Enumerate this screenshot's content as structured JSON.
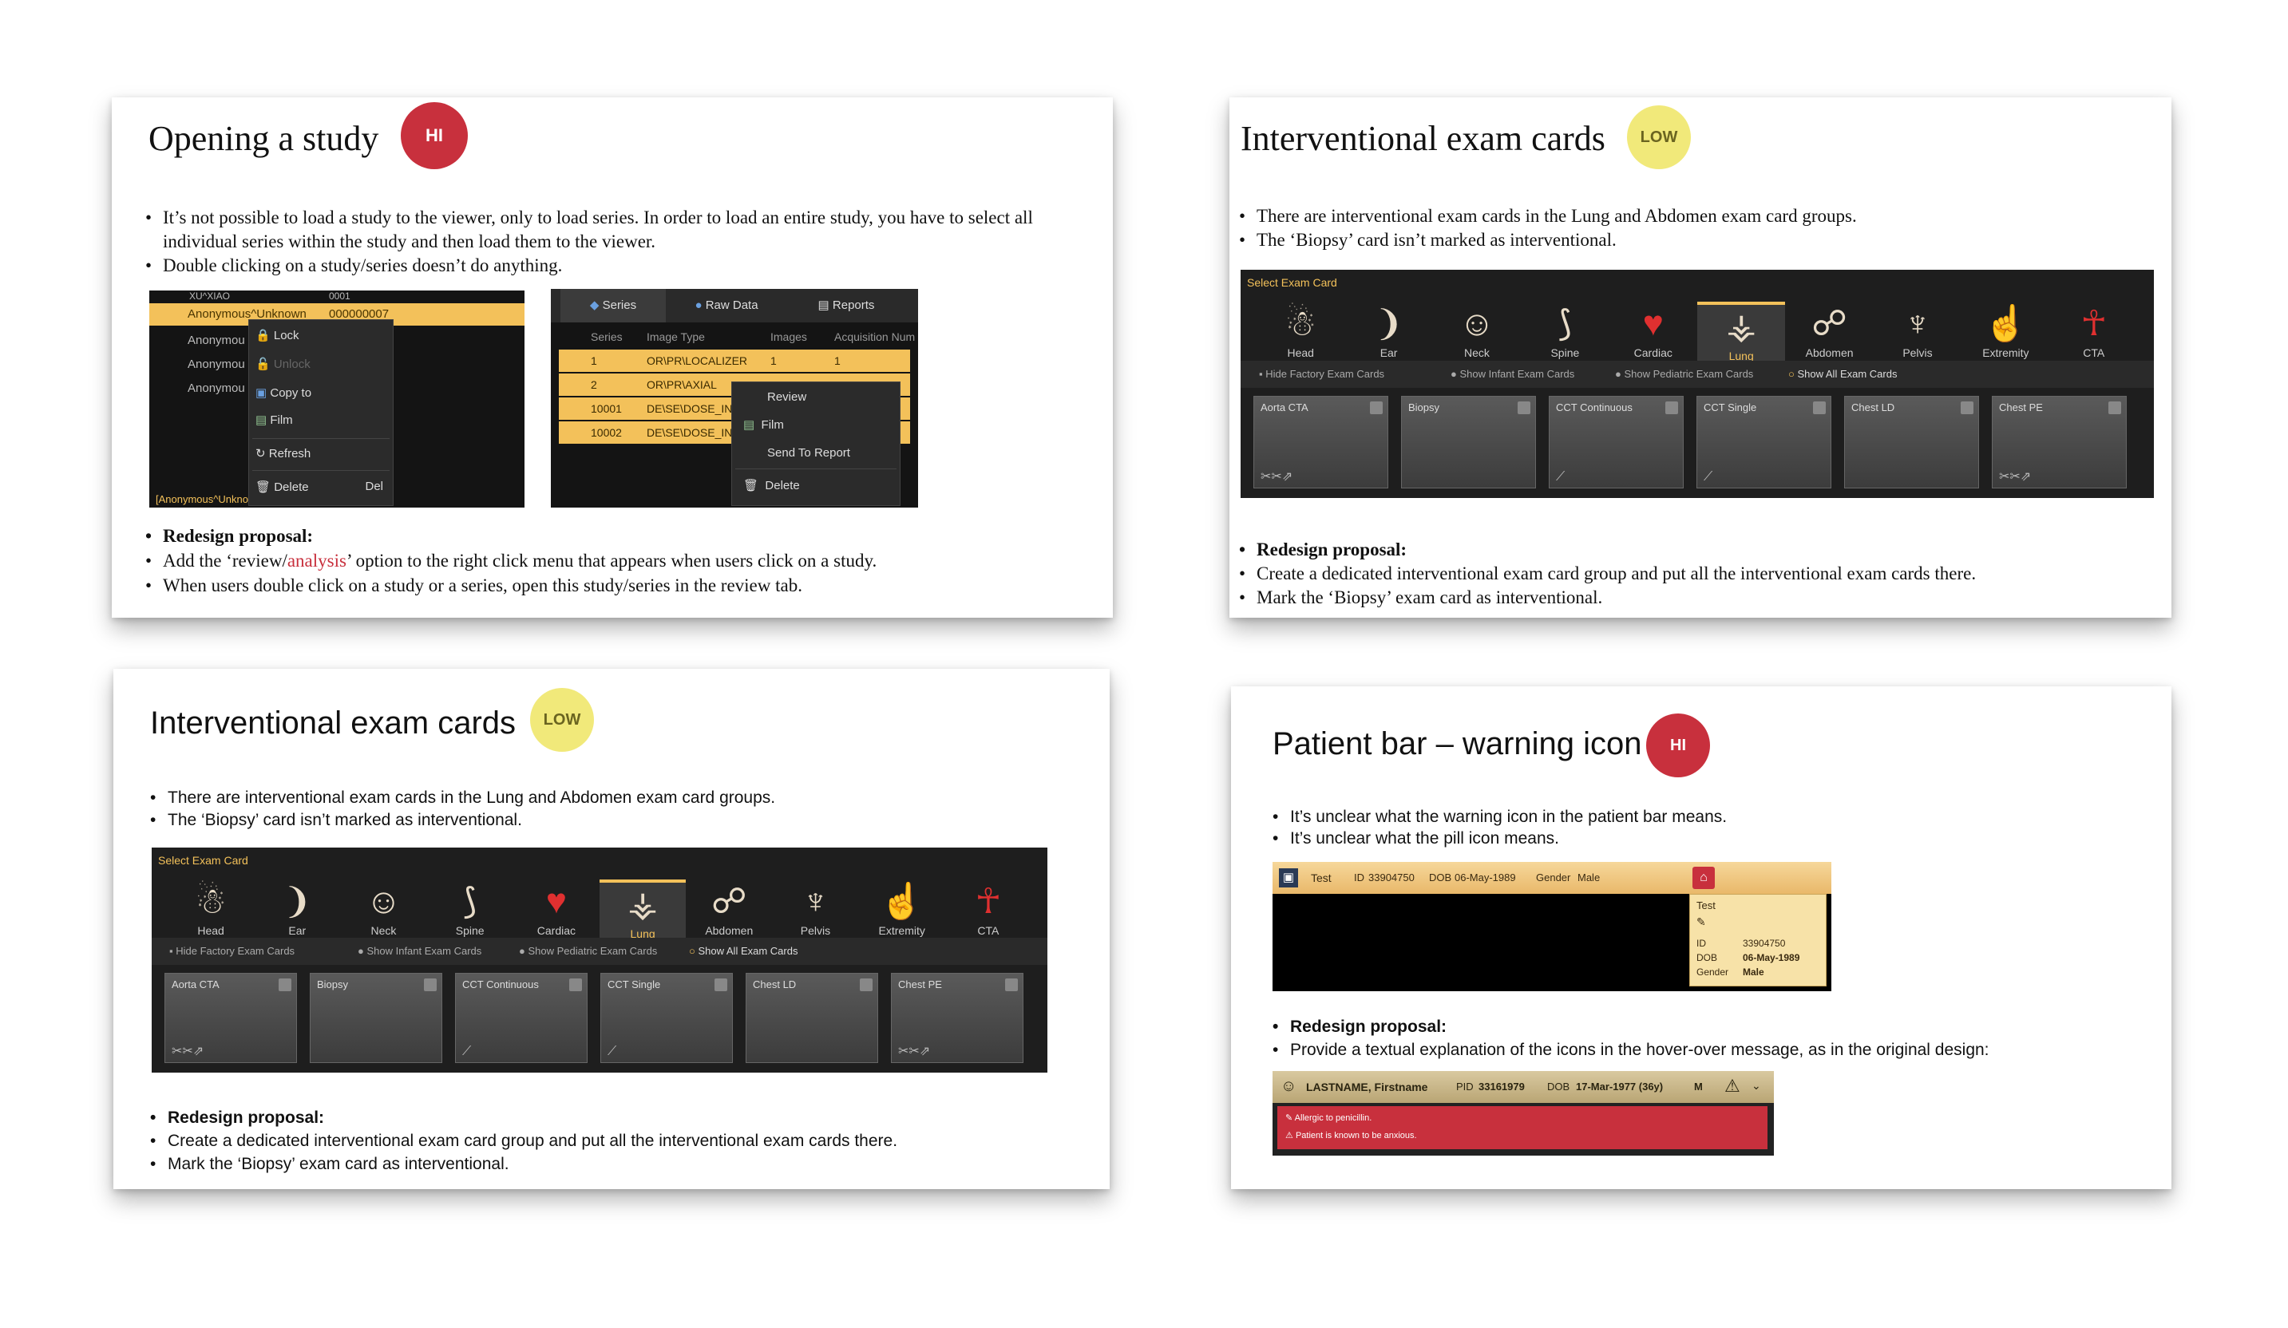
{
  "s1": {
    "title": "Opening a study",
    "badge": "HI",
    "bullets": [
      "It’s not possible to load a study to the viewer, only to load series. In order to load an entire study, you have to select all individual series within the study and then load them to the viewer.",
      "Double clicking on a study/series doesn’t do anything."
    ],
    "list": {
      "row0": [
        "XU^XIAO",
        "0001"
      ],
      "row1": [
        "Anonymous^Unknown",
        "000000007"
      ],
      "rows": [
        "Anonymou",
        "Anonymou",
        "Anonymou"
      ],
      "footer": "[Anonymous^Unknown]"
    },
    "context_menu": [
      "Lock",
      "Unlock",
      "Copy to",
      "Film",
      "Refresh",
      "Delete"
    ],
    "context_menu_shortcut": "Del",
    "tabs": [
      "Series",
      "Raw Data",
      "Reports"
    ],
    "series_headers": [
      "Series",
      "Image Type",
      "Images",
      "Acquisition Num"
    ],
    "series_rows": [
      [
        "1",
        "OR\\PR\\LOCALIZER",
        "1",
        "1"
      ],
      [
        "2",
        "OR\\PR\\AXIAL",
        "",
        ""
      ],
      [
        "10001",
        "DE\\SE\\DOSE_IN",
        "",
        ""
      ],
      [
        "10002",
        "DE\\SE\\DOSE_IN",
        "",
        ""
      ]
    ],
    "series_menu": [
      "Review",
      "Film",
      "Send To Report",
      "Delete"
    ],
    "redesign_label": "Redesign proposal:",
    "redesign_pre": "Add the ‘review/",
    "redesign_red": "analysis",
    "redesign_post": "’ option to the right click menu that appears when users click on a study.",
    "redesign_2": "When users double click on a study or a series, open this study/series in the review tab."
  },
  "s2": {
    "title": "Interventional exam cards",
    "badge": "LOW",
    "bullets": [
      "There are interventional exam cards in the Lung and Abdomen exam card groups.",
      "The ‘Biopsy’ card isn’t marked as interventional."
    ],
    "redesign_label": "Redesign proposal:",
    "redesign": [
      "Create a dedicated interventional exam card group and put all the interventional exam cards there.",
      "Mark the ‘Biopsy’ exam card as interventional."
    ]
  },
  "s3": {
    "title": "Interventional exam cards",
    "badge": "LOW",
    "bullets": [
      "There are interventional exam cards in the Lung and Abdomen exam card groups.",
      "The ‘Biopsy’ card isn’t marked as interventional."
    ],
    "redesign_label": "Redesign proposal:",
    "redesign": [
      "Create a dedicated interventional exam card group and put all the interventional exam cards there.",
      "Mark the ‘Biopsy’ exam card as interventional."
    ]
  },
  "exam": {
    "header": "Select Exam Card",
    "icons": [
      "Head",
      "Ear",
      "Neck",
      "Spine",
      "Cardiac",
      "Lung",
      "Abdomen",
      "Pelvis",
      "Extremity",
      "CTA"
    ],
    "filters": [
      "Hide Factory Exam Cards",
      "Show Infant Exam Cards",
      "Show Pediatric Exam Cards",
      "Show All Exam Cards"
    ],
    "cards": [
      "Aorta CTA",
      "Biopsy",
      "CCT Continuous",
      "CCT Single",
      "Chest LD",
      "Chest PE"
    ]
  },
  "s4": {
    "title": "Patient bar – warning icon",
    "badge": "HI",
    "bullets": [
      "It’s unclear what the warning icon in the patient bar means.",
      "It’s unclear what the pill icon means."
    ],
    "bar": {
      "name": "Test",
      "id_label": "ID",
      "id": "33904750",
      "dob_label": "DOB",
      "dob": "06-May-1989",
      "gender_label": "Gender",
      "gender": "Male"
    },
    "tooltip": {
      "name": "Test",
      "id_label": "ID",
      "id": "33904750",
      "dob_label": "DOB",
      "dob": "06-May-1989",
      "gender_label": "Gender",
      "gender": "Male"
    },
    "redesign_label": "Redesign proposal:",
    "redesign": "Provide a textual explanation of the icons in the hover-over message, as in the original design:",
    "orig": {
      "name": "LASTNAME, Firstname",
      "pid_label": "PID",
      "pid": "33161979",
      "dob_label": "DOB",
      "dob": "17-Mar-1977 (36y)",
      "sex": "M",
      "alerts": [
        "Allergic to penicillin.",
        "Patient is known to be anxious."
      ]
    }
  },
  "colors": {
    "hi": "#c8303d",
    "low": "#f1e97a",
    "highlight": "#f3c15a"
  }
}
